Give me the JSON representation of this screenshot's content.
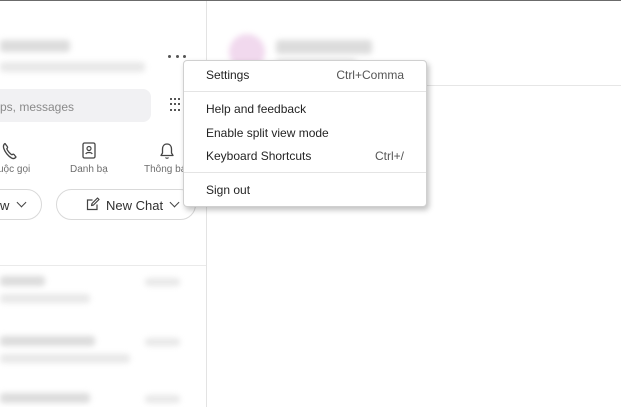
{
  "search": {
    "placeholder": "ps, messages"
  },
  "nav": {
    "calls_label": "uộc gọi",
    "contacts_label": "Danh bạ",
    "notifications_label": "Thông bá"
  },
  "actions": {
    "filter_partial": "w",
    "new_chat_label": "New Chat"
  },
  "menu": {
    "items": [
      {
        "label": "Settings",
        "shortcut": "Ctrl+Comma"
      },
      {
        "label": "Help and feedback",
        "shortcut": ""
      },
      {
        "label": "Enable split view mode",
        "shortcut": ""
      },
      {
        "label": "Keyboard Shortcuts",
        "shortcut": "Ctrl+/"
      },
      {
        "label": "Sign out",
        "shortcut": ""
      }
    ]
  },
  "icons": {
    "more": "more-horizontal-icon",
    "dialpad": "dialpad-icon",
    "calls": "phone-icon",
    "contacts": "contacts-book-icon",
    "notifications": "bell-icon",
    "new_chat": "compose-icon"
  }
}
